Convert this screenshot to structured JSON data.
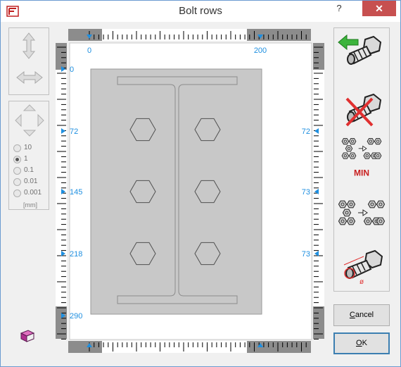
{
  "window": {
    "title": "Bolt rows",
    "help": "?",
    "close": "✕"
  },
  "precision": {
    "options": [
      "10",
      "1",
      "0.1",
      "0.01",
      "0.001"
    ],
    "selected": "1",
    "unit": "[mm]"
  },
  "ruler": {
    "top_labels": [
      "0",
      "200"
    ],
    "left_labels": [
      "0",
      "72",
      "145",
      "218",
      "290"
    ],
    "right_labels": [
      "72",
      "73",
      "73"
    ]
  },
  "tools": {
    "add": "add-bolt-icon",
    "delete": "delete-bolt-icon",
    "min_label": "MIN",
    "distribute": "distribute-bolts-icon",
    "diameter_label": "ø"
  },
  "buttons": {
    "cancel": {
      "pre": "",
      "ul": "C",
      "post": "ancel"
    },
    "ok": {
      "pre": "",
      "ul": "O",
      "post": "K"
    }
  },
  "colors": {
    "accent": "#1e8fe0",
    "plate": "#c8c8c8",
    "add_arrow": "#3cb43c",
    "delete_cross": "#e03030",
    "min_text": "#c81e1e"
  }
}
